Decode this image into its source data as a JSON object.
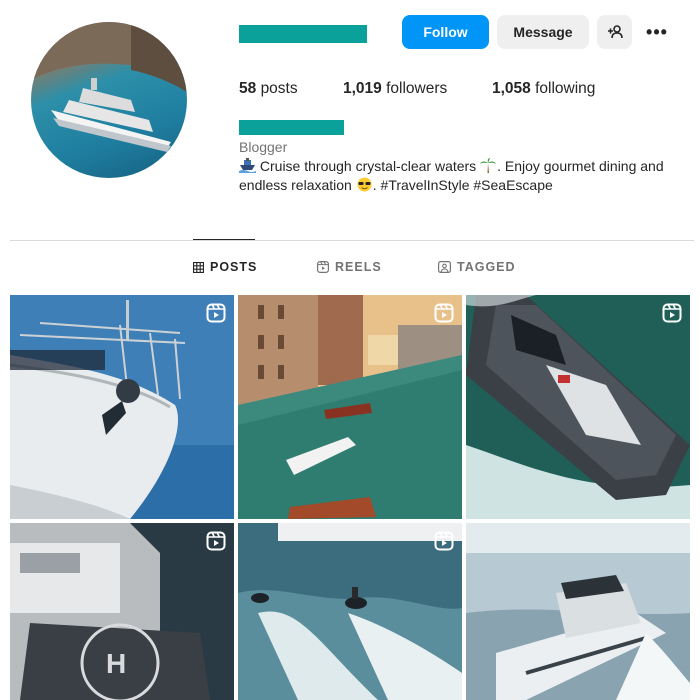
{
  "profile": {
    "avatar_icon": "avatar-yacht-photo",
    "accent_redaction_color": "#0aa19b"
  },
  "actions": {
    "follow_label": "Follow",
    "message_label": "Message",
    "suggest_icon": "person-plus-icon",
    "more_label": "•••"
  },
  "stats": {
    "posts_count": "58",
    "posts_label": "posts",
    "followers_count": "1,019",
    "followers_label": "followers",
    "following_count": "1,058",
    "following_label": "following"
  },
  "bio": {
    "category": "Blogger",
    "line1_text": "Cruise through crystal-clear waters",
    "line1_tail": ". Enjoy gourmet dining and",
    "line2_text": "endless relaxation",
    "line2_tail": ". #TravelInStyle #SeaEscape"
  },
  "tabs": [
    {
      "label": "POSTS",
      "icon": "grid-icon",
      "active": true
    },
    {
      "label": "REELS",
      "icon": "reels-icon",
      "active": false
    },
    {
      "label": "TAGGED",
      "icon": "tagged-icon",
      "active": false
    }
  ],
  "grid": {
    "tiles": [
      {
        "subject": "white yacht bow with railing",
        "badge": "reel-icon"
      },
      {
        "subject": "venice grand canal with boats",
        "badge": "reel-icon"
      },
      {
        "subject": "aerial view of dark yacht cruising",
        "badge": "reel-icon"
      },
      {
        "subject": "yacht deck with helipad",
        "badge": "reel-icon"
      },
      {
        "subject": "jet skis on open water",
        "badge": "reel-icon"
      },
      {
        "subject": "white motor yacht at speed",
        "badge": "none"
      }
    ]
  }
}
